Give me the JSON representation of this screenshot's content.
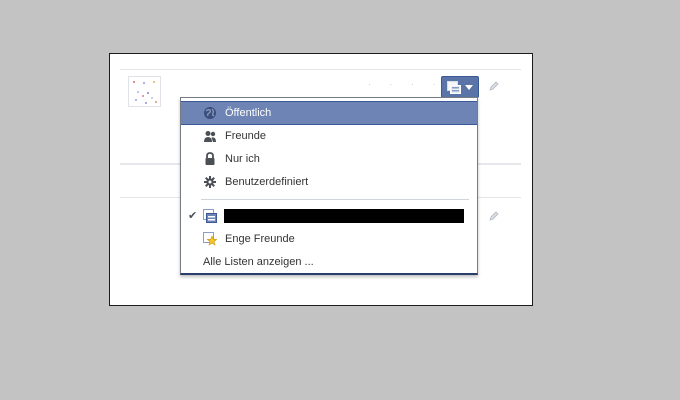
{
  "privacy_menu": {
    "options": [
      {
        "label": "Öffentlich",
        "icon": "globe-icon",
        "selected": true
      },
      {
        "label": "Freunde",
        "icon": "friends-icon",
        "selected": false
      },
      {
        "label": "Nur ich",
        "icon": "lock-icon",
        "selected": false
      },
      {
        "label": "Benutzerdefiniert",
        "icon": "gear-icon",
        "selected": false
      }
    ],
    "lists": [
      {
        "label": "",
        "icon": "custom-list-icon",
        "checked": true,
        "redacted": true
      },
      {
        "label": "Enge Freunde",
        "icon": "star-list-icon",
        "checked": false
      }
    ],
    "all_lists_link": "Alle Listen anzeigen ..."
  },
  "colors": {
    "background": "#c3c3c3",
    "accent": "#6d84b4",
    "accent_border": "#3b5998"
  }
}
